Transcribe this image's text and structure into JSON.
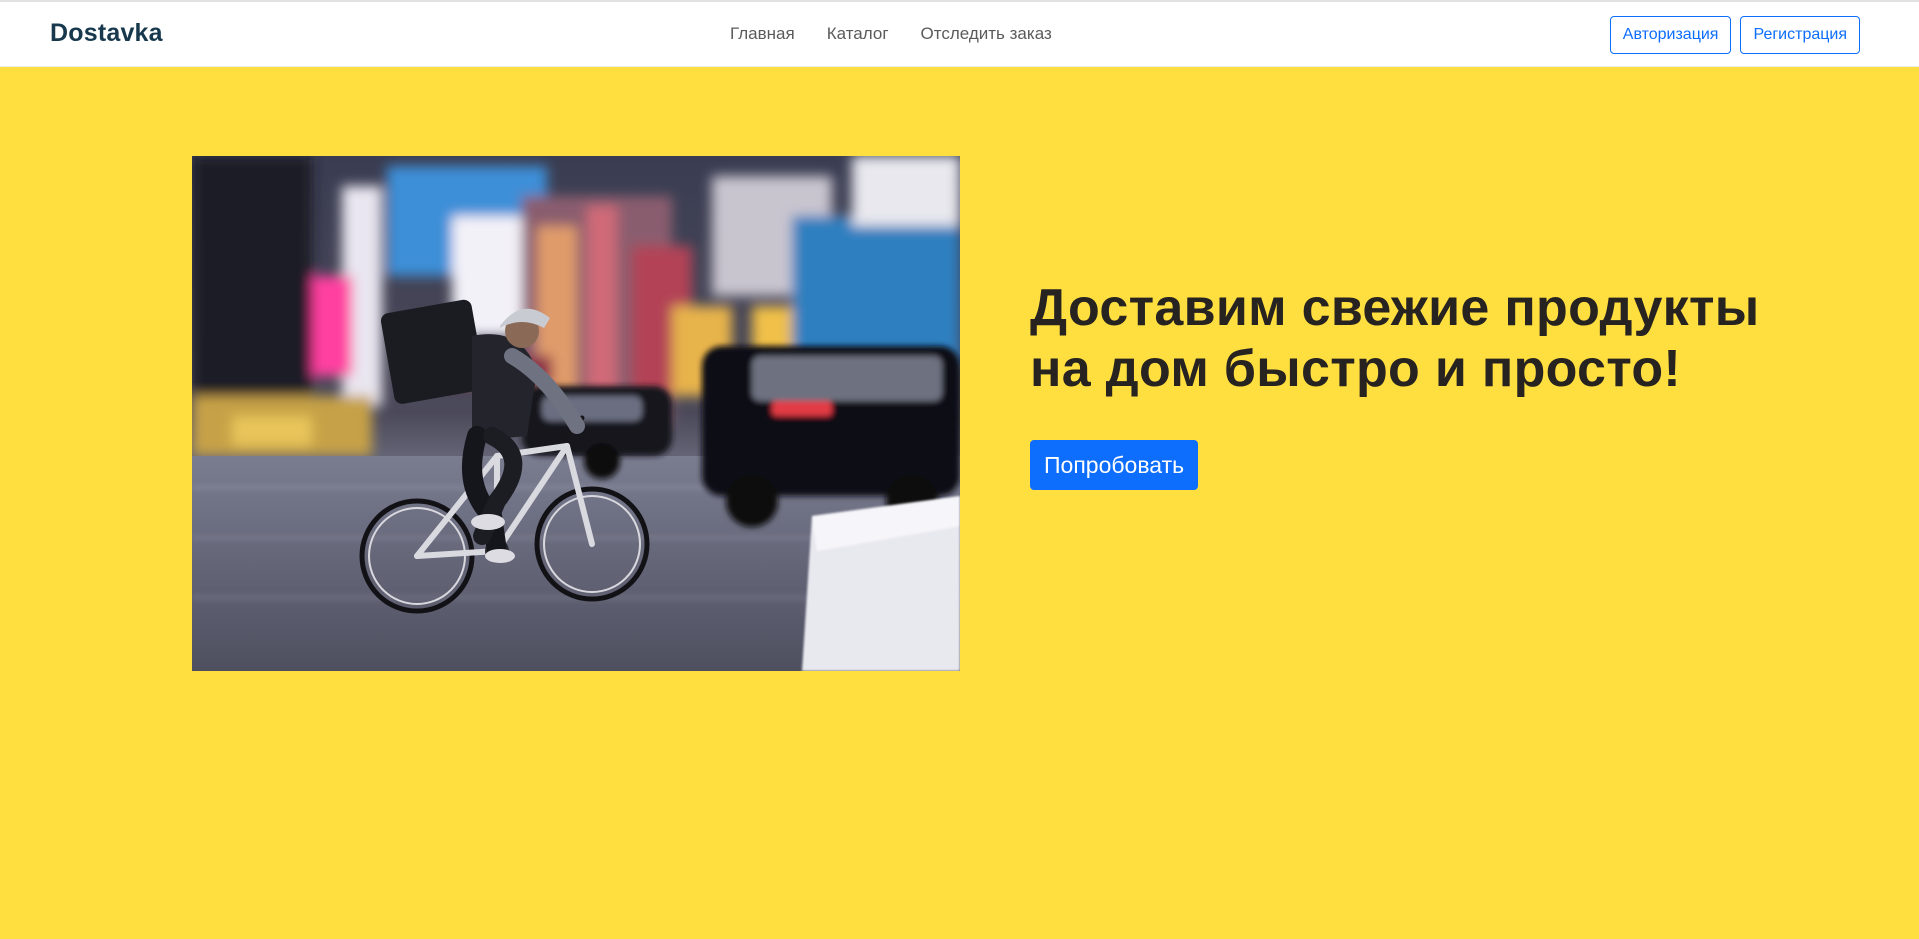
{
  "navbar": {
    "brand": "Dostavka",
    "links": [
      "Главная",
      "Каталог",
      "Отследить заказ"
    ],
    "login_label": "Авторизация",
    "register_label": "Регистрация"
  },
  "hero": {
    "title": "Доставим свежие продукты на дом быстро и просто!",
    "cta_label": "Попробовать",
    "image_icon": "courier-bicycle-photo"
  },
  "colors": {
    "page_background": "#ffde3f",
    "brand": "#17384d",
    "accent": "#0d6efd",
    "title": "#262321",
    "nav_text": "#5b5b5b"
  }
}
